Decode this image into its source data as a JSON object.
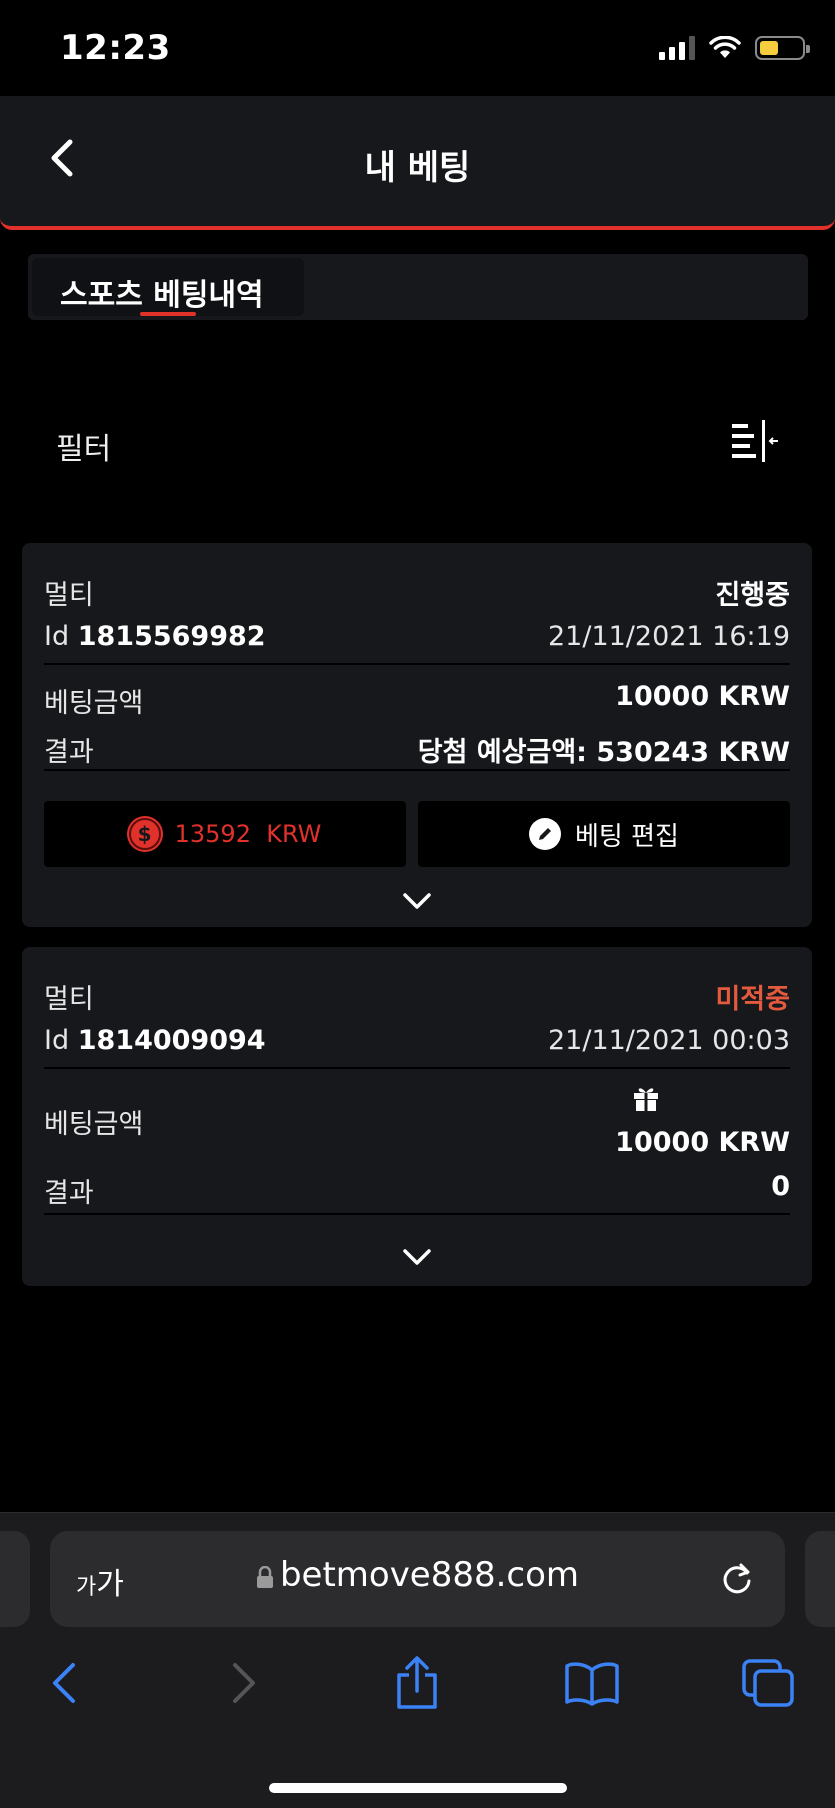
{
  "status": {
    "time": "12:23"
  },
  "header": {
    "title": "내 베팅"
  },
  "tabs": [
    {
      "label": "스포츠 베팅내역",
      "active": true
    }
  ],
  "filter": {
    "label": "필터"
  },
  "bets": [
    {
      "type": "멀티",
      "status": "진행중",
      "id_prefix": "Id",
      "id": "1815569982",
      "datetime": "21/11/2021 16:19",
      "stake_label": "베팅금액",
      "stake": "10000 KRW",
      "result_label": "결과",
      "result": "당첨 예상금액: 530243 KRW",
      "cashout": "13592  KRW",
      "edit_label": "베팅 편집"
    },
    {
      "type": "멀티",
      "status": "미적중",
      "id_prefix": "Id",
      "id": "1814009094",
      "datetime": "21/11/2021 00:03",
      "stake_label": "베팅금액",
      "stake": "10000 KRW",
      "result_label": "결과",
      "result": "0"
    }
  ],
  "browser": {
    "text_size_small": "가",
    "text_size_large": "가",
    "url": "betmove888.com"
  },
  "colors": {
    "accent": "#e0312b",
    "lost": "#e35a3e",
    "ios_blue": "#3b82f6"
  }
}
